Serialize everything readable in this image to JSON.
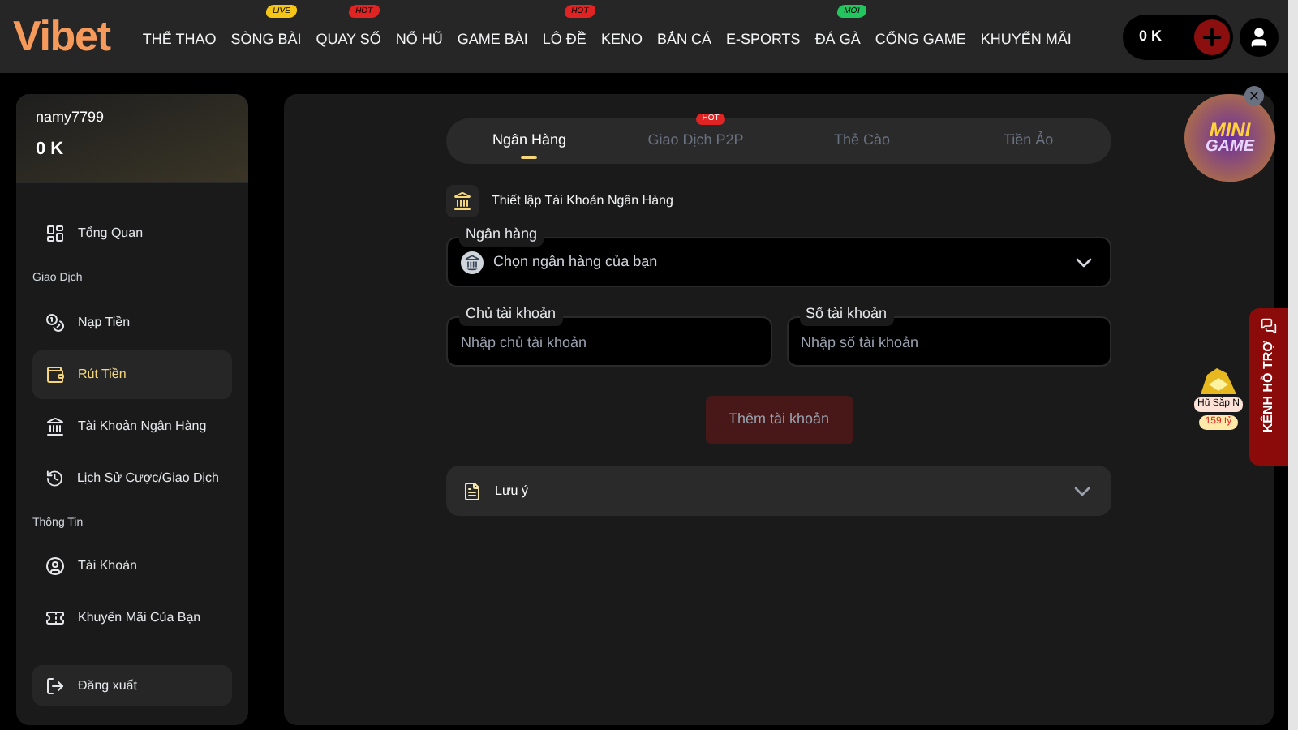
{
  "header": {
    "logo": "Vibet",
    "nav": [
      {
        "label": "THỂ THAO"
      },
      {
        "label": "SÒNG BÀI",
        "badge": "LIVE",
        "color": "#f5c518"
      },
      {
        "label": "QUAY SỐ",
        "badge": "HOT",
        "color": "#e02424"
      },
      {
        "label": "NỔ HŨ"
      },
      {
        "label": "GAME BÀI"
      },
      {
        "label": "LÔ ĐỀ",
        "badge": "HOT",
        "color": "#e02424"
      },
      {
        "label": "KENO"
      },
      {
        "label": "BẮN CÁ"
      },
      {
        "label": "E-SPORTS"
      },
      {
        "label": "ĐÁ GÀ",
        "badge": "MỚI",
        "color": "#22c55e"
      },
      {
        "label": "CỔNG GAME"
      },
      {
        "label": "KHUYẾN MÃI"
      }
    ],
    "balance": "0 K"
  },
  "sidebar": {
    "username": "namy7799",
    "balance": "0 K",
    "sections": [
      {
        "items": [
          {
            "label": "Tổng Quan",
            "selected": false
          }
        ]
      },
      {
        "title": "Giao Dịch",
        "items": [
          {
            "label": "Nạp Tiền",
            "selected": false
          },
          {
            "label": "Rút Tiền",
            "selected": true
          },
          {
            "label": "Tài Khoản Ngân Hàng",
            "selected": false
          },
          {
            "label": "Lịch Sử Cược/Giao Dịch",
            "selected": false
          }
        ]
      },
      {
        "title": "Thông Tin",
        "items": [
          {
            "label": "Tài Khoản",
            "selected": false
          },
          {
            "label": "Khuyến Mãi Của Bạn",
            "selected": false
          }
        ]
      }
    ],
    "logout": "Đăng xuất"
  },
  "tabs": [
    {
      "label": "Ngân Hàng",
      "selected": true
    },
    {
      "label": "Giao Dịch P2P",
      "selected": false,
      "badge": "HOT"
    },
    {
      "label": "Thẻ Cào",
      "selected": false
    },
    {
      "label": "Tiền Ảo",
      "selected": false
    }
  ],
  "section_title": "Thiết lập Tài Khoản Ngân Hàng",
  "bank_field": {
    "label": "Ngân hàng",
    "placeholder": "Chọn ngân hàng của bạn"
  },
  "owner_field": {
    "label": "Chủ tài khoản",
    "placeholder": "Nhập chủ tài khoản"
  },
  "number_field": {
    "label": "Số tài khoản",
    "placeholder": "Nhập số tài khoản"
  },
  "submit": {
    "label": "Thêm tài khoản",
    "disabled": true
  },
  "note": {
    "label": "Lưu ý",
    "expanded": false
  },
  "minigame": {
    "line1": "MINI",
    "line2": "GAME"
  },
  "jackpot": {
    "label": "Hũ Sắp N",
    "amount": "159 tỷ"
  },
  "support": "KÊNH HỖ TRỢ"
}
